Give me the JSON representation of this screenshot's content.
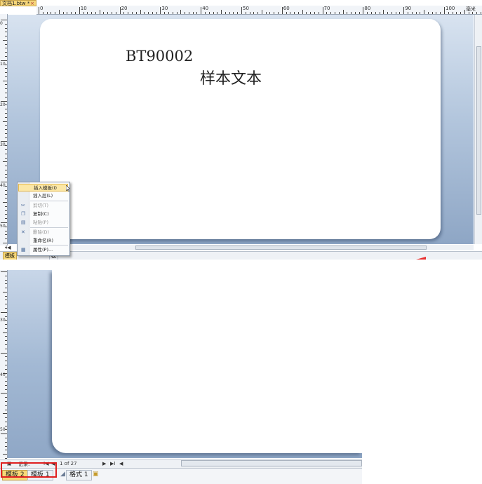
{
  "top": {
    "doc_tab_label": "文档1.btw *",
    "doc_tab_close": "×",
    "ruler_h_numbers": [
      "0",
      "10",
      "20",
      "30",
      "40",
      "50",
      "60",
      "70",
      "80",
      "90",
      "100"
    ],
    "ruler_v_numbers": [
      "0",
      "10",
      "20",
      "30",
      "40",
      "50"
    ],
    "ruler_unit": "毫米",
    "label_text_code": "BT90002",
    "label_text_sample": "样本文本",
    "nav": {
      "first": "I◀",
      "prev": "◀",
      "next": "▶",
      "last": "▶I"
    },
    "mini_tabs": [
      "模板",
      "模"
    ]
  },
  "context_menu": {
    "items": [
      {
        "label": "插入模板(I)",
        "icon": "",
        "disabled": false,
        "highlighted": true
      },
      {
        "label": "插入层(L)",
        "icon": "",
        "disabled": false,
        "highlighted": false
      },
      {
        "label": "剪切(T)",
        "icon": "scissors-icon",
        "disabled": true,
        "highlighted": false
      },
      {
        "label": "复制(C)",
        "icon": "copy-icon",
        "disabled": false,
        "highlighted": false
      },
      {
        "label": "粘贴(P)",
        "icon": "paste-icon",
        "disabled": true,
        "highlighted": false
      },
      {
        "label": "删除(D)",
        "icon": "delete-icon",
        "disabled": true,
        "highlighted": false
      },
      {
        "label": "重命名(R)",
        "icon": "",
        "disabled": false,
        "highlighted": false
      },
      {
        "label": "属性(P)...",
        "icon": "properties-icon",
        "disabled": false,
        "highlighted": false
      }
    ]
  },
  "bottom": {
    "ruler_v_numbers": [
      "30",
      "40",
      "50"
    ],
    "record_label": "记录:",
    "record_position": "1 of 27",
    "tabs": [
      {
        "label": "模板 2",
        "active": true
      },
      {
        "label": "模板 1",
        "active": false
      },
      {
        "label": "格式 1",
        "active": false
      }
    ]
  },
  "colors": {
    "accent_tab": "#f7d878",
    "canvas_blue": "#8fa7c6",
    "highlight_red": "#e02020"
  }
}
